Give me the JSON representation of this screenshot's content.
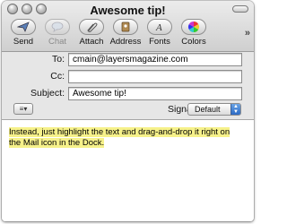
{
  "window": {
    "title": "Awesome tip!"
  },
  "toolbar": {
    "send_label": "Send",
    "chat_label": "Chat",
    "attach_label": "Attach",
    "address_label": "Address",
    "fonts_label": "Fonts",
    "colors_label": "Colors",
    "overflow_label": "»"
  },
  "headers": {
    "to_label": "To:",
    "to_value": "cmain@layersmagazine.com",
    "cc_label": "Cc:",
    "cc_value": "",
    "subject_label": "Subject:",
    "subject_value": "Awesome tip!"
  },
  "options": {
    "action_glyph": "≡▾",
    "signature_label": "Signature:",
    "signature_value": "Default"
  },
  "body": {
    "text": "Instead, just highlight the text and drag-and-drop it right on the Mail icon in the Dock.",
    "highlight_color": "#f6f18a"
  }
}
